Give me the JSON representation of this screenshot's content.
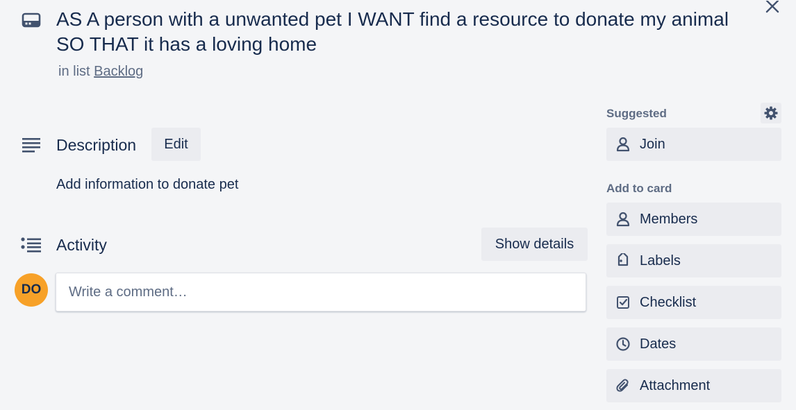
{
  "card": {
    "title": "AS A person with a unwanted pet I WANT find a resource to donate my animal SO THAT it has a loving home",
    "list_prefix": "in list",
    "list_name": "Backlog"
  },
  "description": {
    "heading": "Description",
    "edit_label": "Edit",
    "text": "Add information to donate pet"
  },
  "activity": {
    "heading": "Activity",
    "show_details_label": "Show details",
    "avatar_initials": "DO",
    "comment_placeholder": "Write a comment…"
  },
  "sidebar": {
    "suggested_label": "Suggested",
    "join_label": "Join",
    "add_to_card_label": "Add to card",
    "items": [
      {
        "label": "Members",
        "icon": "person-icon"
      },
      {
        "label": "Labels",
        "icon": "tag-icon"
      },
      {
        "label": "Checklist",
        "icon": "checkbox-icon"
      },
      {
        "label": "Dates",
        "icon": "clock-icon"
      },
      {
        "label": "Attachment",
        "icon": "paperclip-icon"
      }
    ]
  },
  "colors": {
    "background": "#f4f5f7",
    "button": "#ebecf0",
    "avatar": "#f7a128",
    "text": "#172b4d",
    "muted": "#5e6c84"
  }
}
